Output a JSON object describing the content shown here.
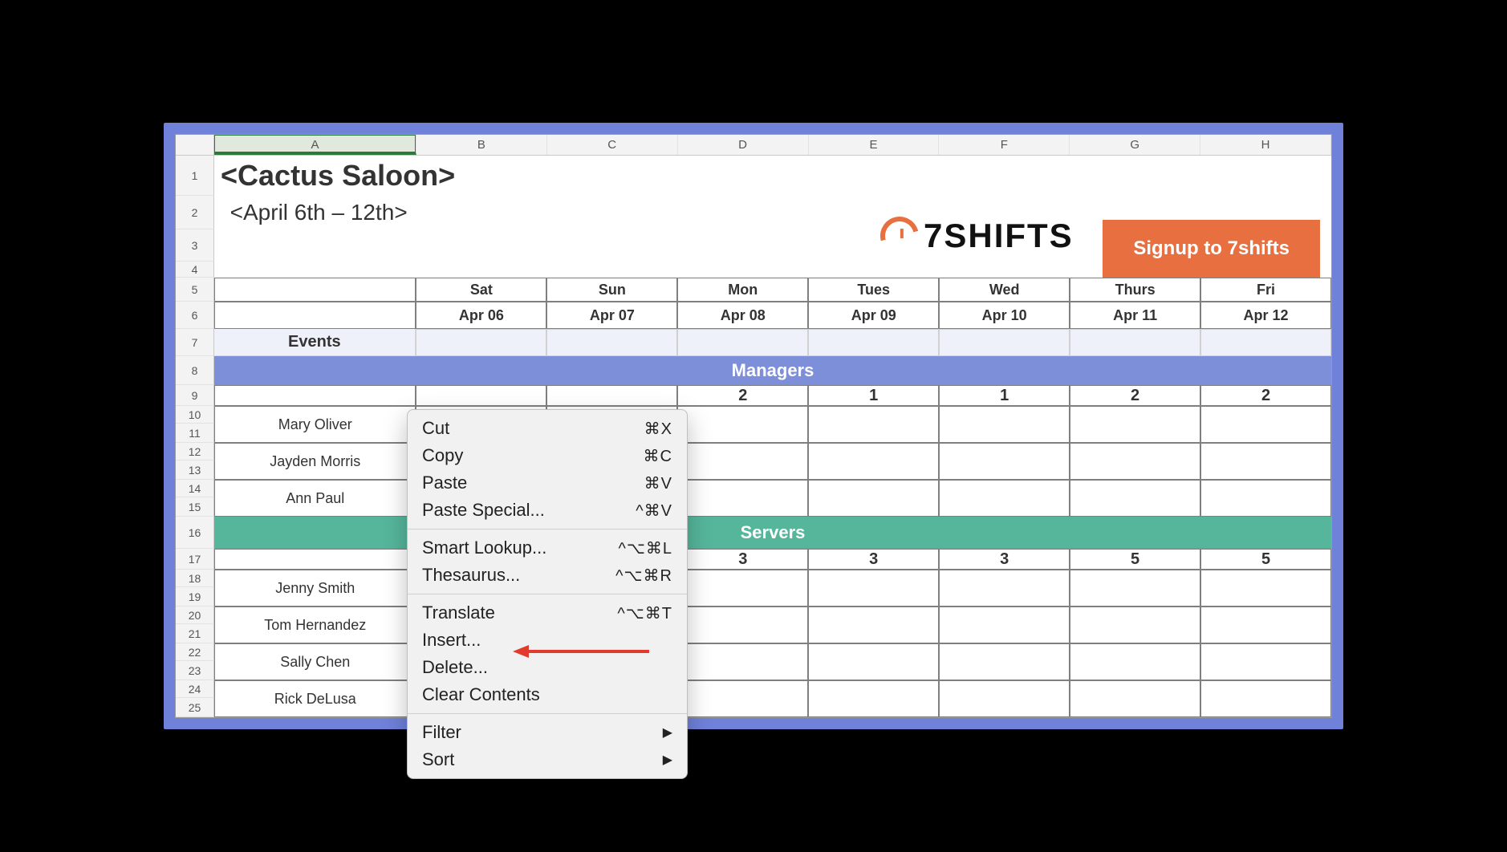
{
  "columns": [
    "A",
    "B",
    "C",
    "D",
    "E",
    "F",
    "G",
    "H"
  ],
  "active_column": "A",
  "row_numbers": [
    1,
    2,
    3,
    4,
    5,
    6,
    7,
    8,
    9,
    10,
    11,
    12,
    13,
    14,
    15,
    16,
    17,
    18,
    19,
    20,
    21,
    22,
    23,
    24,
    25
  ],
  "title": "<Cactus Saloon>",
  "subtitle": "<April 6th – 12th>",
  "logo_text": "7SHIFTS",
  "signup_label": "Signup to 7shifts",
  "day_headers": [
    "Sat",
    "Sun",
    "Mon",
    "Tues",
    "Wed",
    "Thurs",
    "Fri"
  ],
  "date_headers": [
    "Apr 06",
    "Apr 07",
    "Apr 08",
    "Apr 09",
    "Apr 10",
    "Apr 11",
    "Apr 12"
  ],
  "events_label": "Events",
  "sections": {
    "managers": {
      "label": "Managers",
      "counts": [
        "",
        "",
        "2",
        "1",
        "1",
        "2",
        "2"
      ],
      "names": [
        "Mary Oliver",
        "Jayden Morris",
        "Ann Paul"
      ]
    },
    "servers": {
      "label": "Servers",
      "counts": [
        "",
        "",
        "3",
        "3",
        "3",
        "5",
        "5"
      ],
      "names": [
        "Jenny Smith",
        "Tom Hernandez",
        "Sally Chen",
        "Rick DeLusa"
      ]
    }
  },
  "context_menu": {
    "groups": [
      [
        {
          "label": "Cut",
          "shortcut": "⌘X"
        },
        {
          "label": "Copy",
          "shortcut": "⌘C"
        },
        {
          "label": "Paste",
          "shortcut": "⌘V"
        },
        {
          "label": "Paste Special...",
          "shortcut": "^⌘V"
        }
      ],
      [
        {
          "label": "Smart Lookup...",
          "shortcut": "^⌥⌘L"
        },
        {
          "label": "Thesaurus...",
          "shortcut": "^⌥⌘R"
        }
      ],
      [
        {
          "label": "Translate",
          "shortcut": "^⌥⌘T"
        },
        {
          "label": "Insert...",
          "shortcut": ""
        },
        {
          "label": "Delete...",
          "shortcut": ""
        },
        {
          "label": "Clear Contents",
          "shortcut": ""
        }
      ],
      [
        {
          "label": "Filter",
          "submenu": true
        },
        {
          "label": "Sort",
          "submenu": true
        }
      ]
    ]
  },
  "row_heights": {
    "r1": 50,
    "r2": 42,
    "r3": 40,
    "r4": 20,
    "r5": 30,
    "r6": 34,
    "r7": 34,
    "r8": 36,
    "r9": 26,
    "r10": 22,
    "r11": 24,
    "r12": 22,
    "r13": 24,
    "r14": 22,
    "r15": 24,
    "r16": 40,
    "r17": 26,
    "r18": 22,
    "r19": 24,
    "r20": 22,
    "r21": 24,
    "r22": 22,
    "r23": 24,
    "r24": 22,
    "r25": 24
  }
}
